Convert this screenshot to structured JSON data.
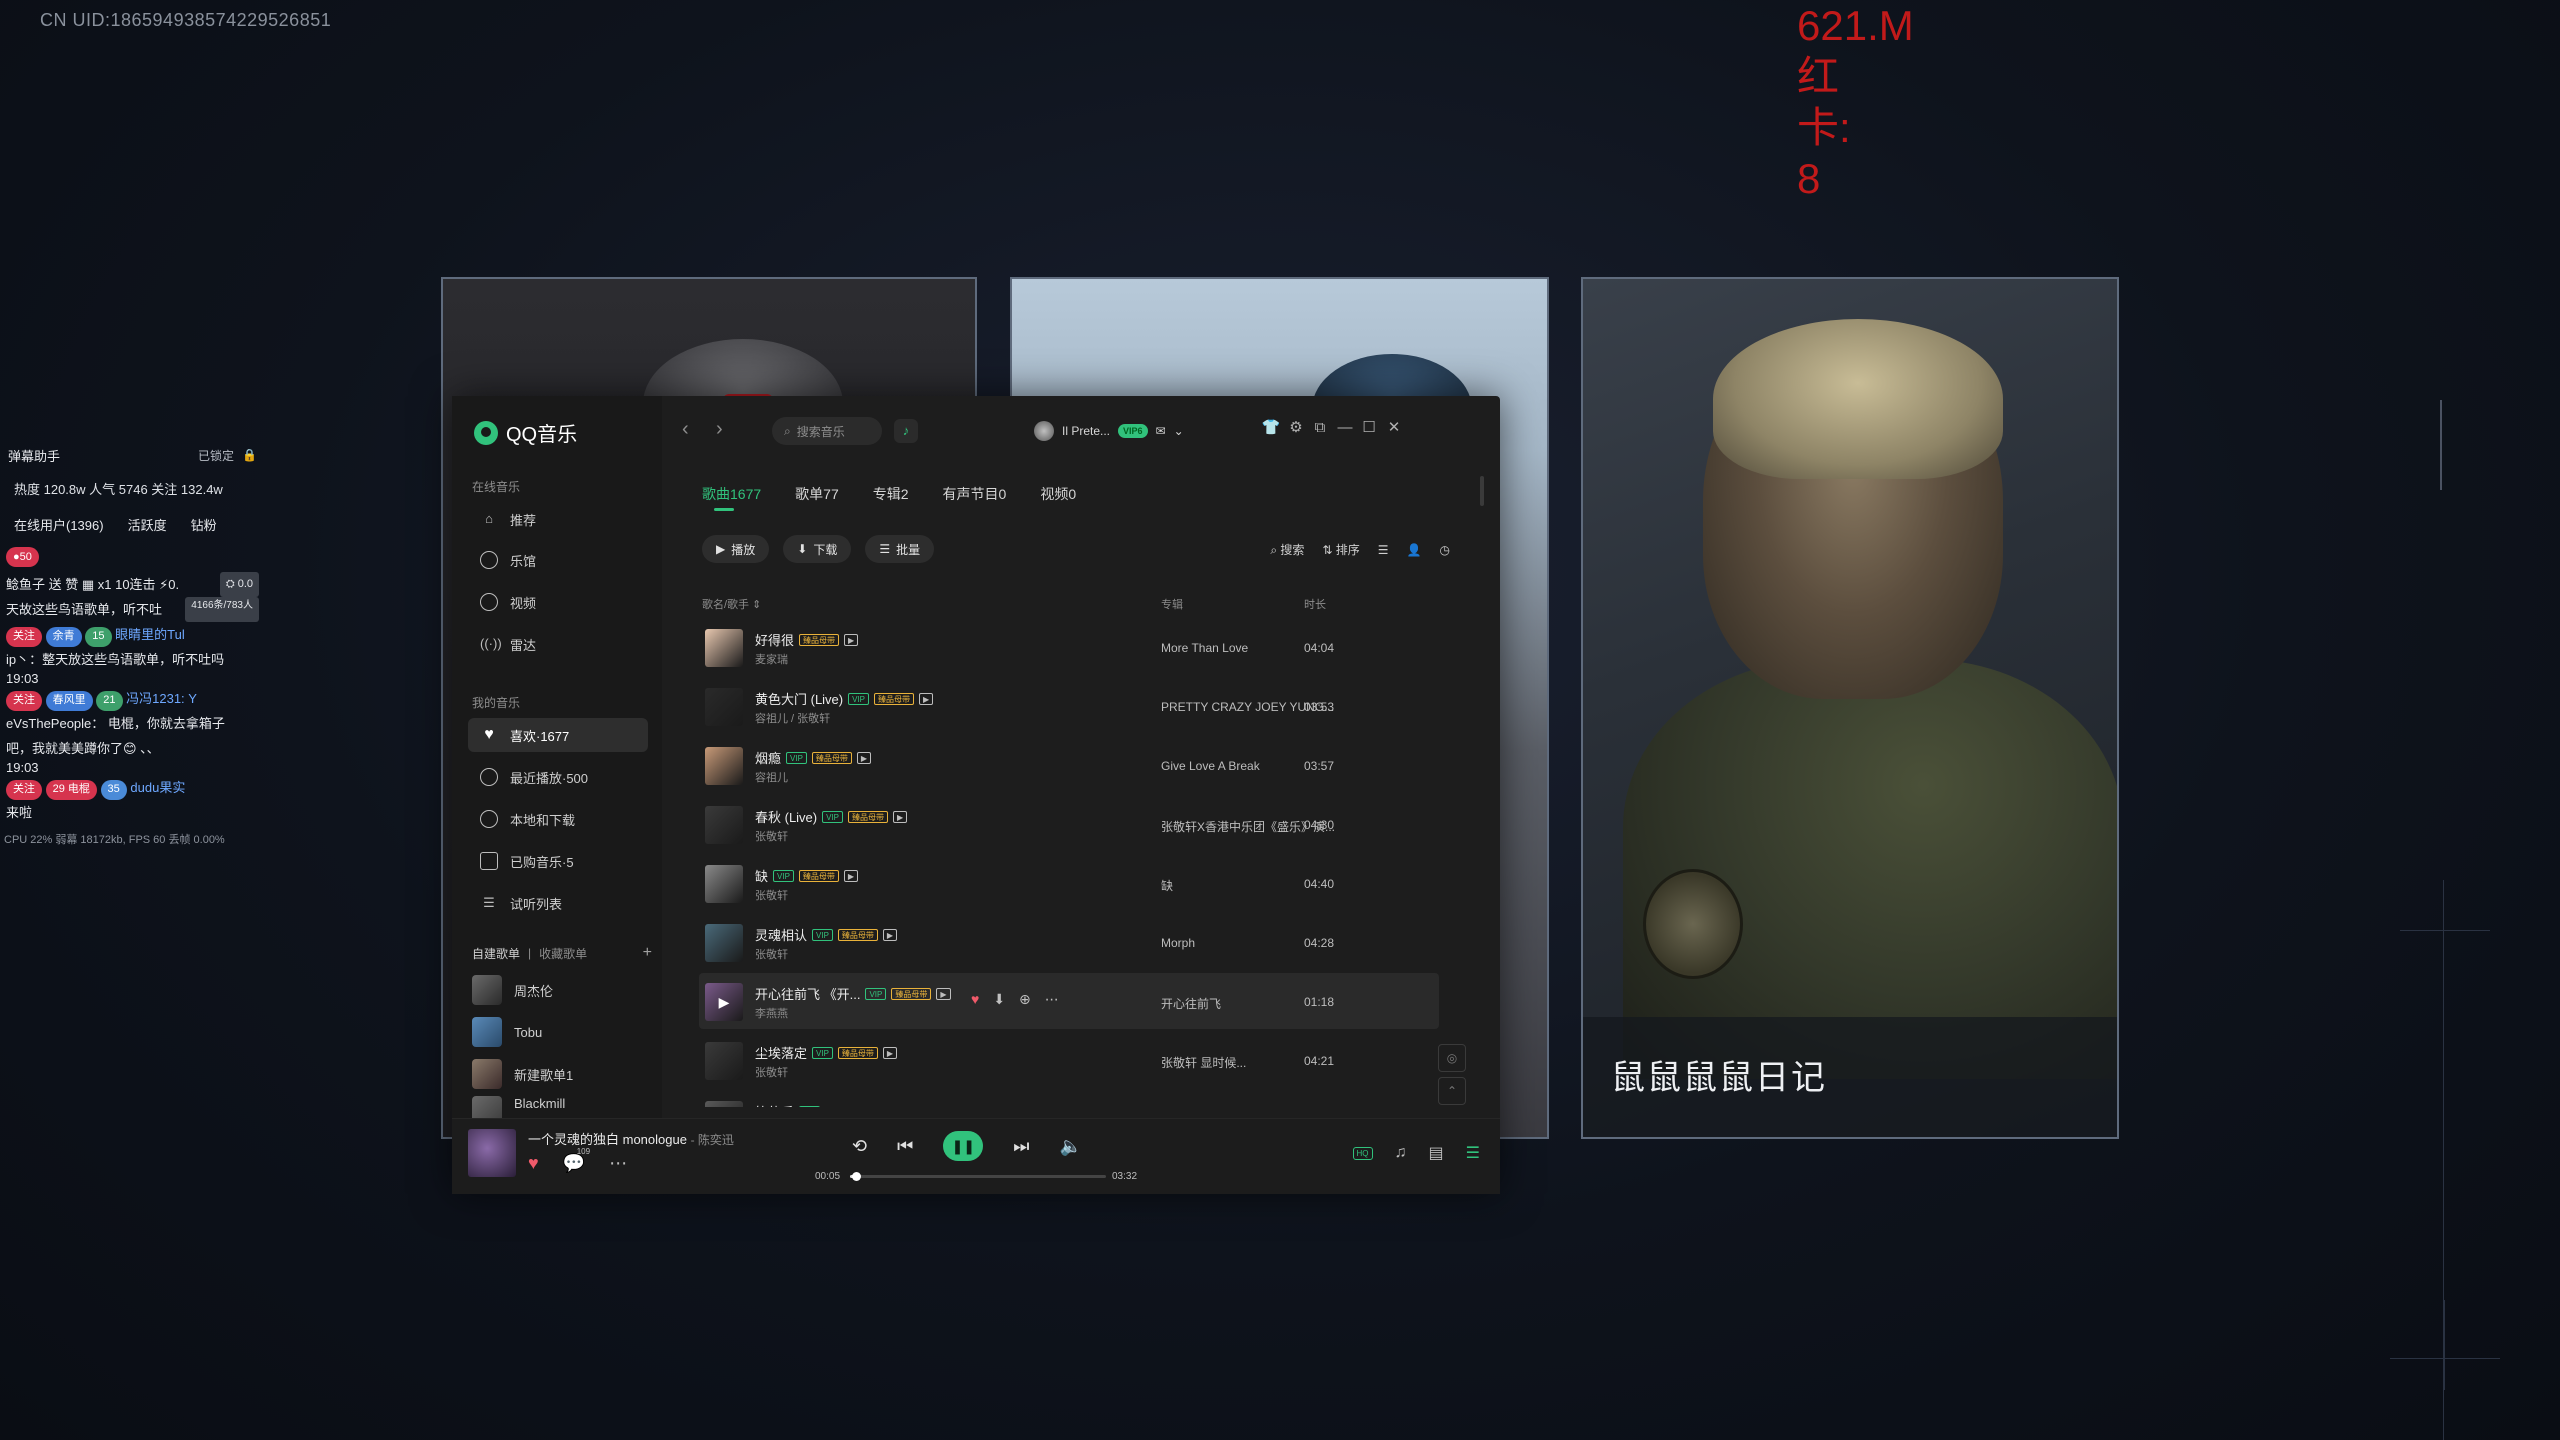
{
  "overlay": {
    "uid": "CN UID:186594938574229526851",
    "red_stat": "621.M\n红\n卡:\n8",
    "card3_caption": "鼠鼠鼠鼠日记"
  },
  "live": {
    "title": "弹幕助手",
    "lock_label": "已锁定",
    "stats": "热度 120.8w 人气 5746 关注 132.4w",
    "tabs": [
      "在线用户(1396)",
      "活跃度",
      "钻粉"
    ],
    "badge_count": "50",
    "gift_line": "鲶鱼子 送 赞",
    "gift_count": "x1 10连击",
    "gift_right": "0.0",
    "msg_count": "4166条/783人",
    "rows": [
      {
        "text": "天故这些鸟语歌单，听不吐"
      },
      {
        "pills": [
          "关注",
          "余青",
          "15"
        ],
        "user": "眼睛里的Tul"
      },
      {
        "text": "ip丶：整天放这些鸟语歌单，听不吐吗"
      },
      {
        "time": "19:03"
      },
      {
        "pills": [
          "关注",
          "春风里",
          "21"
        ],
        "user": "冯冯1231: Y"
      },
      {
        "text": "eVsThePeople： 电棍，你就去拿箱子"
      },
      {
        "text": "吧，我就美美蹲你了😊 、、"
      },
      {
        "time": "19:03"
      },
      {
        "pills": [
          "关注",
          "29 电棍",
          "35"
        ],
        "user": "dudu果实"
      },
      {
        "text": "来啦"
      }
    ],
    "cpu": "CPU 22% 弱幕 18172kb, FPS 60 丢帧 0.00%"
  },
  "qq": {
    "logo": "QQ音乐",
    "sections": {
      "online": "在线音乐",
      "mine": "我的音乐"
    },
    "nav_online": [
      {
        "label": "推荐"
      },
      {
        "label": "乐馆"
      },
      {
        "label": "视频"
      },
      {
        "label": "雷达"
      }
    ],
    "nav_mine": [
      {
        "label": "喜欢·1677"
      },
      {
        "label": "最近播放·500"
      },
      {
        "label": "本地和下载"
      },
      {
        "label": "已购音乐·5"
      },
      {
        "label": "试听列表"
      }
    ],
    "playlist_head": {
      "created": "自建歌单",
      "collected": "收藏歌单"
    },
    "playlists": [
      {
        "label": "周杰伦"
      },
      {
        "label": "Tobu"
      },
      {
        "label": "新建歌单1"
      },
      {
        "label": "Blackmill"
      }
    ],
    "search_placeholder": "搜索音乐",
    "user_name": "Il Prete...",
    "vip_label": "VIP6",
    "tabs": [
      "歌曲1677",
      "歌单77",
      "专辑2",
      "有声节目0",
      "视频0"
    ],
    "actions": [
      "播放",
      "下载",
      "批量"
    ],
    "tools": [
      "搜索",
      "排序"
    ],
    "columns": {
      "title": "歌名/歌手 ⇕",
      "album": "专辑",
      "duration": "时长"
    },
    "songs": [
      {
        "title": "好得很",
        "artist": "麦家瑞",
        "album": "More Than Love",
        "duration": "04:04",
        "tags": [
          "h",
          "m"
        ]
      },
      {
        "title": "黄色大门 (Live)",
        "artist": "容祖儿 / 张敬轩",
        "album": "PRETTY CRAZY JOEY YUNG...",
        "duration": "03:53",
        "tags": [
          "v",
          "h",
          "m"
        ]
      },
      {
        "title": "烟瘾",
        "artist": "容祖儿",
        "album": "Give Love A Break",
        "duration": "03:57",
        "tags": [
          "v",
          "h",
          "m"
        ]
      },
      {
        "title": "春秋 (Live)",
        "artist": "张敬轩",
        "album": "张敬轩X香港中乐团《盛乐》演...",
        "duration": "04:30",
        "tags": [
          "v",
          "h",
          "m"
        ]
      },
      {
        "title": "缺",
        "artist": "张敬轩",
        "album": "缺",
        "duration": "04:40",
        "tags": [
          "v",
          "h",
          "m"
        ]
      },
      {
        "title": "灵魂相认",
        "artist": "张敬轩",
        "album": "Morph",
        "duration": "04:28",
        "tags": [
          "v",
          "h",
          "m"
        ]
      },
      {
        "title": "开心往前飞 《开...",
        "artist": "李燕燕",
        "album": "开心往前飞",
        "duration": "01:18",
        "tags": [
          "v",
          "h",
          "m"
        ]
      },
      {
        "title": "尘埃落定",
        "artist": "张敬轩",
        "album": "张敬轩 显时候...",
        "duration": "04:21",
        "tags": [
          "v",
          "h",
          "m"
        ]
      },
      {
        "title": "笑的手",
        "artist": "",
        "album": "",
        "duration": "",
        "tags": [
          "v"
        ]
      }
    ],
    "now_playing": {
      "title": "一个灵魂的独白 monologue",
      "artist": "- 陈奕迅",
      "comment_count": "109",
      "elapsed": "00:05",
      "total": "03:32",
      "progress": 0.0236
    },
    "hq_label": "HQ",
    "colors": {
      "accent": "#31c27c",
      "heart": "#f05a6a",
      "red_stat": "#c21a1a"
    }
  }
}
